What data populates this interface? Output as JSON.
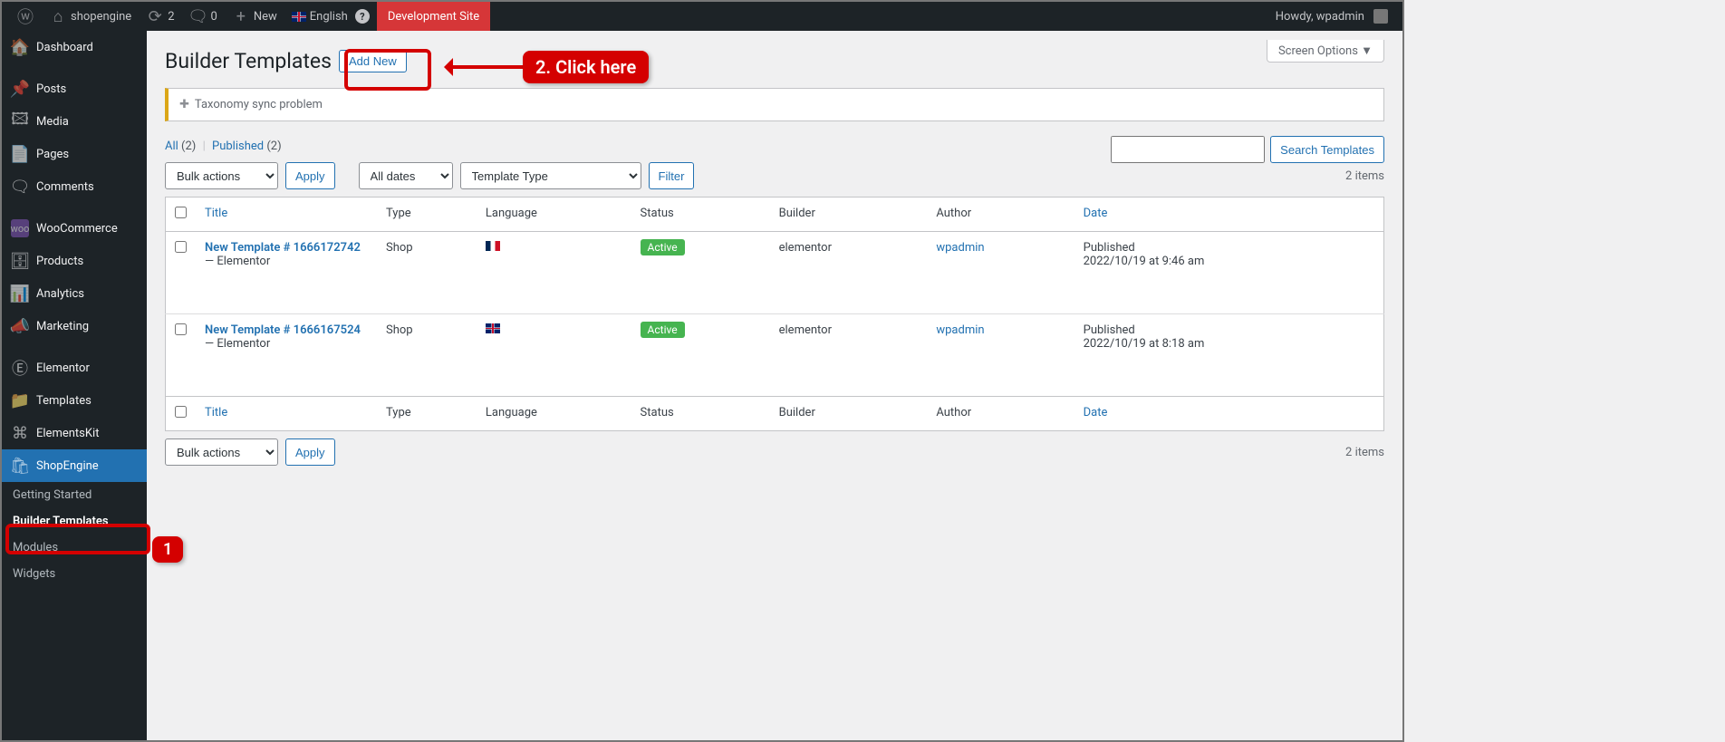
{
  "adminbar": {
    "site_title": "shopengine",
    "updates_count": "2",
    "comments_count": "0",
    "new_label": "New",
    "lang_label": "English",
    "dev_label": "Development Site",
    "howdy": "Howdy, wpadmin"
  },
  "sidebar": {
    "items": [
      {
        "label": "Dashboard",
        "icon": "⌂"
      },
      {
        "label": "Posts",
        "icon": "📌"
      },
      {
        "label": "Media",
        "icon": "🖼"
      },
      {
        "label": "Pages",
        "icon": "📄"
      },
      {
        "label": "Comments",
        "icon": "💬"
      },
      {
        "label": "WooCommerce",
        "icon": "W"
      },
      {
        "label": "Products",
        "icon": "🗄"
      },
      {
        "label": "Analytics",
        "icon": "📊"
      },
      {
        "label": "Marketing",
        "icon": "📣"
      },
      {
        "label": "Elementor",
        "icon": "E"
      },
      {
        "label": "Templates",
        "icon": "📁"
      },
      {
        "label": "ElementsKit",
        "icon": "EK"
      },
      {
        "label": "ShopEngine",
        "icon": "🛒"
      }
    ],
    "sub": {
      "getting_started": "Getting Started",
      "builder_templates": "Builder Templates",
      "modules": "Modules",
      "widgets": "Widgets"
    }
  },
  "page": {
    "title": "Builder Templates",
    "add_new": "Add New",
    "screen_options": "Screen Options ▼"
  },
  "notice": {
    "text": "Taxonomy sync problem"
  },
  "filters": {
    "all_label": "All",
    "all_count": "(2)",
    "published_label": "Published",
    "published_count": "(2)",
    "bulk_actions": "Bulk actions",
    "apply": "Apply",
    "all_dates": "All dates",
    "template_type": "Template Type",
    "filter": "Filter",
    "count_text": "2 items",
    "search_btn": "Search Templates"
  },
  "table": {
    "headers": {
      "title": "Title",
      "type": "Type",
      "language": "Language",
      "status": "Status",
      "builder": "Builder",
      "author": "Author",
      "date": "Date"
    },
    "rows": [
      {
        "title": "New Template # 1666172742",
        "suffix": " — Elementor",
        "type": "Shop",
        "flag": "fr",
        "status": "Active",
        "builder": "elementor",
        "author": "wpadmin",
        "date_label": "Published",
        "date_value": "2022/10/19 at 9:46 am"
      },
      {
        "title": "New Template # 1666167524",
        "suffix": " — Elementor",
        "type": "Shop",
        "flag": "uk",
        "status": "Active",
        "builder": "elementor",
        "author": "wpadmin",
        "date_label": "Published",
        "date_value": "2022/10/19 at 8:18 am"
      }
    ]
  },
  "annotations": {
    "callout1": "1",
    "callout2": "2. Click here"
  }
}
